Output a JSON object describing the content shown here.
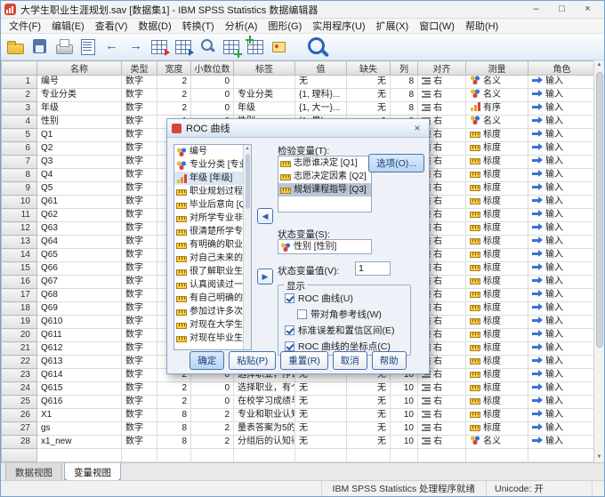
{
  "window": {
    "title": "大学生职业生涯规划.sav [数据集1] - IBM SPSS Statistics 数据编辑器",
    "controls": {
      "minimize": "–",
      "maximize": "□",
      "close": "×"
    }
  },
  "menu": {
    "items": [
      "文件(F)",
      "编辑(E)",
      "查看(V)",
      "数据(D)",
      "转换(T)",
      "分析(A)",
      "图形(G)",
      "实用程序(U)",
      "扩展(X)",
      "窗口(W)",
      "帮助(H)"
    ]
  },
  "toolbar": {
    "icons": [
      "open-data",
      "save",
      "print",
      "recall-dialogs",
      "undo",
      "redo",
      "goto-case",
      "goto-variable",
      "find",
      "insert-case",
      "insert-variable",
      "value-labels",
      "search"
    ]
  },
  "grid": {
    "headers": [
      "名称",
      "类型",
      "宽度",
      "小数位数",
      "标签",
      "值",
      "缺失",
      "列",
      "对齐",
      "测量",
      "角色"
    ],
    "rows": [
      {
        "num": "1",
        "name": "编号",
        "type": "数字",
        "width": "2",
        "decimals": "0",
        "label": "",
        "values": "无",
        "missing": "无",
        "columns": "8",
        "align": "右",
        "measure": "名义",
        "role": "输入"
      },
      {
        "num": "2",
        "name": "专业分类",
        "type": "数字",
        "width": "2",
        "decimals": "0",
        "label": "专业分类",
        "values": "{1, 理科}...",
        "missing": "无",
        "columns": "8",
        "align": "右",
        "measure": "名义",
        "role": "输入"
      },
      {
        "num": "3",
        "name": "年级",
        "type": "数字",
        "width": "2",
        "decimals": "0",
        "label": "年级",
        "values": "{1, 大一}...",
        "missing": "无",
        "columns": "8",
        "align": "右",
        "measure": "有序",
        "role": "输入"
      },
      {
        "num": "4",
        "name": "性别",
        "type": "数字",
        "width": "1",
        "decimals": "0",
        "label": "性别",
        "values": "{1, 男}...",
        "missing": "9",
        "columns": "8",
        "align": "右",
        "measure": "名义",
        "role": "输入"
      },
      {
        "num": "5",
        "name": "Q1",
        "type": "数字",
        "width": "2",
        "decimals": "",
        "label": "",
        "values": "",
        "missing": "",
        "columns": "",
        "align": "右",
        "measure": "标度",
        "role": "输入"
      },
      {
        "num": "6",
        "name": "Q2",
        "type": "数字",
        "width": "2",
        "decimals": "",
        "label": "",
        "values": "",
        "missing": "",
        "columns": "",
        "align": "右",
        "measure": "标度",
        "role": "输入"
      },
      {
        "num": "7",
        "name": "Q3",
        "type": "数字",
        "width": "2",
        "decimals": "",
        "label": "",
        "values": "",
        "missing": "",
        "columns": "",
        "align": "右",
        "measure": "标度",
        "role": "输入"
      },
      {
        "num": "8",
        "name": "Q4",
        "type": "数字",
        "width": "2",
        "decimals": "",
        "label": "",
        "values": "",
        "missing": "",
        "columns": "",
        "align": "右",
        "measure": "标度",
        "role": "输入"
      },
      {
        "num": "9",
        "name": "Q5",
        "type": "数字",
        "width": "2",
        "decimals": "",
        "label": "",
        "values": "",
        "missing": "",
        "columns": "",
        "align": "右",
        "measure": "标度",
        "role": "输入"
      },
      {
        "num": "10",
        "name": "Q61",
        "type": "数字",
        "width": "2",
        "decimals": "",
        "label": "",
        "values": "",
        "missing": "",
        "columns": "",
        "align": "右",
        "measure": "标度",
        "role": "输入"
      },
      {
        "num": "11",
        "name": "Q62",
        "type": "数字",
        "width": "2",
        "decimals": "",
        "label": "",
        "values": "",
        "missing": "",
        "columns": "",
        "align": "右",
        "measure": "标度",
        "role": "输入"
      },
      {
        "num": "12",
        "name": "Q63",
        "type": "数字",
        "width": "2",
        "decimals": "",
        "label": "",
        "values": "",
        "missing": "",
        "columns": "",
        "align": "右",
        "measure": "标度",
        "role": "输入"
      },
      {
        "num": "13",
        "name": "Q64",
        "type": "数字",
        "width": "2",
        "decimals": "",
        "label": "",
        "values": "",
        "missing": "",
        "columns": "",
        "align": "右",
        "measure": "标度",
        "role": "输入"
      },
      {
        "num": "14",
        "name": "Q65",
        "type": "数字",
        "width": "2",
        "decimals": "",
        "label": "",
        "values": "",
        "missing": "",
        "columns": "",
        "align": "右",
        "measure": "标度",
        "role": "输入"
      },
      {
        "num": "15",
        "name": "Q66",
        "type": "数字",
        "width": "2",
        "decimals": "",
        "label": "",
        "values": "",
        "missing": "",
        "columns": "",
        "align": "右",
        "measure": "标度",
        "role": "输入"
      },
      {
        "num": "16",
        "name": "Q67",
        "type": "数字",
        "width": "2",
        "decimals": "",
        "label": "",
        "values": "",
        "missing": "",
        "columns": "",
        "align": "右",
        "measure": "标度",
        "role": "输入"
      },
      {
        "num": "17",
        "name": "Q68",
        "type": "数字",
        "width": "2",
        "decimals": "",
        "label": "",
        "values": "",
        "missing": "",
        "columns": "",
        "align": "右",
        "measure": "标度",
        "role": "输入"
      },
      {
        "num": "18",
        "name": "Q69",
        "type": "数字",
        "width": "2",
        "decimals": "",
        "label": "",
        "values": "",
        "missing": "",
        "columns": "",
        "align": "右",
        "measure": "标度",
        "role": "输入"
      },
      {
        "num": "19",
        "name": "Q610",
        "type": "数字",
        "width": "2",
        "decimals": "",
        "label": "",
        "values": "",
        "missing": "",
        "columns": "",
        "align": "右",
        "measure": "标度",
        "role": "输入"
      },
      {
        "num": "20",
        "name": "Q611",
        "type": "数字",
        "width": "2",
        "decimals": "",
        "label": "",
        "values": "",
        "missing": "",
        "columns": "",
        "align": "右",
        "measure": "标度",
        "role": "输入"
      },
      {
        "num": "21",
        "name": "Q612",
        "type": "数字",
        "width": "2",
        "decimals": "",
        "label": "",
        "values": "",
        "missing": "",
        "columns": "",
        "align": "右",
        "measure": "标度",
        "role": "输入"
      },
      {
        "num": "22",
        "name": "Q613",
        "type": "数字",
        "width": "2",
        "decimals": "",
        "label": "",
        "values": "",
        "missing": "",
        "columns": "",
        "align": "右",
        "measure": "标度",
        "role": "输入"
      },
      {
        "num": "23",
        "name": "Q614",
        "type": "数字",
        "width": "2",
        "decimals": "0",
        "label": "选择职业，挣钱...",
        "values": "无",
        "missing": "无",
        "columns": "10",
        "align": "右",
        "measure": "标度",
        "role": "输入"
      },
      {
        "num": "24",
        "name": "Q615",
        "type": "数字",
        "width": "2",
        "decimals": "0",
        "label": "选择职业，有个...",
        "values": "无",
        "missing": "无",
        "columns": "10",
        "align": "右",
        "measure": "标度",
        "role": "输入"
      },
      {
        "num": "25",
        "name": "Q616",
        "type": "数字",
        "width": "2",
        "decimals": "0",
        "label": "在校学习成绩与...",
        "values": "无",
        "missing": "无",
        "columns": "10",
        "align": "右",
        "measure": "标度",
        "role": "输入"
      },
      {
        "num": "26",
        "name": "X1",
        "type": "数字",
        "width": "8",
        "decimals": "2",
        "label": "专业和职业认知...",
        "values": "无",
        "missing": "无",
        "columns": "10",
        "align": "右",
        "measure": "标度",
        "role": "输入"
      },
      {
        "num": "27",
        "name": "gs",
        "type": "数字",
        "width": "8",
        "decimals": "2",
        "label": "量表答案为5的...",
        "values": "无",
        "missing": "无",
        "columns": "10",
        "align": "右",
        "measure": "标度",
        "role": "输入"
      },
      {
        "num": "28",
        "name": "x1_new",
        "type": "数字",
        "width": "8",
        "decimals": "2",
        "label": "分组后的认知得...",
        "values": "无",
        "missing": "无",
        "columns": "10",
        "align": "右",
        "measure": "名义",
        "role": "输入"
      }
    ]
  },
  "dialog": {
    "title": "ROC 曲线",
    "close_glyph": "×",
    "icons": {
      "arrow_left": "◀",
      "arrow_right": "▶"
    },
    "source_variables": [
      {
        "label": "编号",
        "measure": "nominal"
      },
      {
        "label": "专业分类 [专业...",
        "measure": "nominal"
      },
      {
        "label": "年级 [年级]",
        "measure": "ordinal",
        "focused": true
      },
      {
        "label": "职业规划过程中...",
        "measure": "scale"
      },
      {
        "label": "毕业后意向 [Q5]",
        "measure": "scale"
      },
      {
        "label": "对所学专业非常...",
        "measure": "scale"
      },
      {
        "label": "很清楚所学专业...",
        "measure": "scale"
      },
      {
        "label": "有明确的职业目...",
        "measure": "scale"
      },
      {
        "label": "对自己未来的职...",
        "measure": "scale"
      },
      {
        "label": "很了解职业生涯...",
        "measure": "scale"
      },
      {
        "label": "认真阅读过一些...",
        "measure": "scale"
      },
      {
        "label": "有自己明确的...",
        "measure": "scale"
      },
      {
        "label": "参加过许多次...",
        "measure": "scale"
      },
      {
        "label": "对现在大学生就...",
        "measure": "scale"
      },
      {
        "label": "对现在毕业生...",
        "measure": "scale"
      }
    ],
    "test_label": "检验变量(T):",
    "test_variables": [
      {
        "label": "志愿谁决定 [Q1]",
        "measure": "scale",
        "selected": false
      },
      {
        "label": "志愿决定因素 [Q2]",
        "measure": "scale",
        "selected": false
      },
      {
        "label": "规划课程指导 [Q3]",
        "measure": "scale",
        "selected": true
      }
    ],
    "state_label": "状态变量(S):",
    "state_variable": "性别 [性别]",
    "state_value_label": "状态变量值(V):",
    "state_value": "1",
    "display_label": "显示",
    "checkboxes": [
      {
        "label": "ROC 曲线(U)",
        "checked": true,
        "indent": false
      },
      {
        "label": "带对角参考线(W)",
        "checked": false,
        "indent": true
      },
      {
        "label": "标准误差和置信区间(E)",
        "checked": true,
        "indent": false
      },
      {
        "label": "ROC 曲线的坐标点(C)",
        "checked": true,
        "indent": false
      }
    ],
    "options_button": "选项(O)...",
    "buttons": {
      "ok": "确定",
      "paste": "粘贴(P)",
      "reset": "重置(R)",
      "cancel": "取消",
      "help": "帮助"
    }
  },
  "tabs": {
    "data_view": "数据视图",
    "variable_view": "变量视图"
  },
  "statusbar": {
    "message": "IBM SPSS Statistics 处理程序就绪",
    "unicode": "Unicode:  开"
  },
  "scroll_glyphs": {
    "up": "▲",
    "down": "▼"
  }
}
